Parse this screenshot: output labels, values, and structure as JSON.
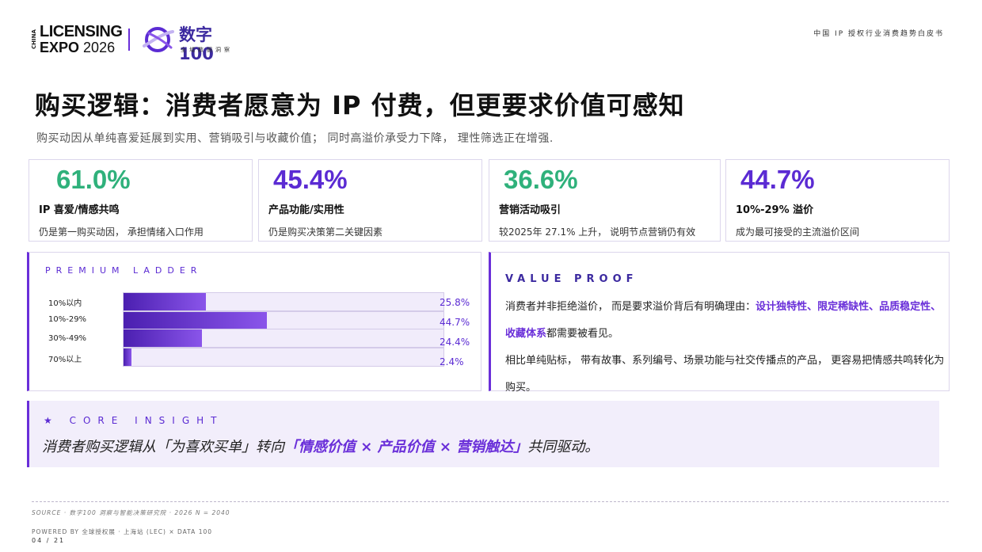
{
  "header": {
    "logo_china": "CHINA",
    "logo_top": "LICENSING",
    "logo_bottom_word": "EXPO",
    "logo_bottom_year": "2026",
    "brand_name": "数字100",
    "brand_sub": "全域数据洞察",
    "doc_title": "中国 IP 授权行业消费趋势白皮书"
  },
  "page": {
    "title": "购买逻辑：消费者愿意为 IP 付费，但更要求价值可感知",
    "subtitle": "购买动因从单纯喜爱延展到实用、营销吸引与收藏价值； 同时高溢价承受力下降， 理性筛选正在增强."
  },
  "kpis": [
    {
      "value": "61.0%",
      "label": "IP 喜爱/情感共鸣",
      "desc": "仍是第一购买动因， 承担情绪入口作用",
      "color": "#2fb17b"
    },
    {
      "value": "45.4%",
      "label": "产品功能/实用性",
      "desc": "仍是购买决策第二关键因素",
      "color": "#5b2bd3"
    },
    {
      "value": "36.6%",
      "label": "营销活动吸引",
      "desc": "较2025年 27.1% 上升， 说明节点营销仍有效",
      "color": "#2fb17b"
    },
    {
      "value": "44.7%",
      "label": "10%-29% 溢价",
      "desc": "成为最可接受的主流溢价区间",
      "color": "#5b2bd3"
    }
  ],
  "ladder": {
    "title": "PREMIUM LADDER",
    "rows": [
      {
        "label": "10%以内",
        "value_text": "25.8%",
        "value": 25.8
      },
      {
        "label": "10%-29%",
        "value_text": "44.7%",
        "value": 44.7
      },
      {
        "label": "30%-49%",
        "value_text": "24.4%",
        "value": 24.4
      },
      {
        "label": "70%以上",
        "value_text": "2.4%",
        "value": 2.4
      }
    ]
  },
  "proof": {
    "title": "VALUE PROOF",
    "p1_a": "消费者并非拒绝溢价， 而是要求溢价背后有明确理由：",
    "p1_hl": "设计独特性、限定稀缺性、品质稳定性、收藏体系",
    "p1_b": "都需要被看见。",
    "p2": "相比单纯贴标， 带有故事、系列编号、场景功能与社交传播点的产品， 更容易把情感共鸣转化为购买。"
  },
  "insight": {
    "star": "★",
    "title": "CORE INSIGHT",
    "text_a": "消费者购买逻辑从「为喜欢买单」转向",
    "text_hl": "「情感价值 × 产品价值 × 营销触达」",
    "text_b": "共同驱动。"
  },
  "footer": {
    "source": "SOURCE · 数字100 洞察与智能决策研究院 · 2026 N = 2040",
    "powered": "POWERED BY 全球授权展 · 上海站 (LEC) × DATA 100",
    "pager": "04 / 21"
  }
}
